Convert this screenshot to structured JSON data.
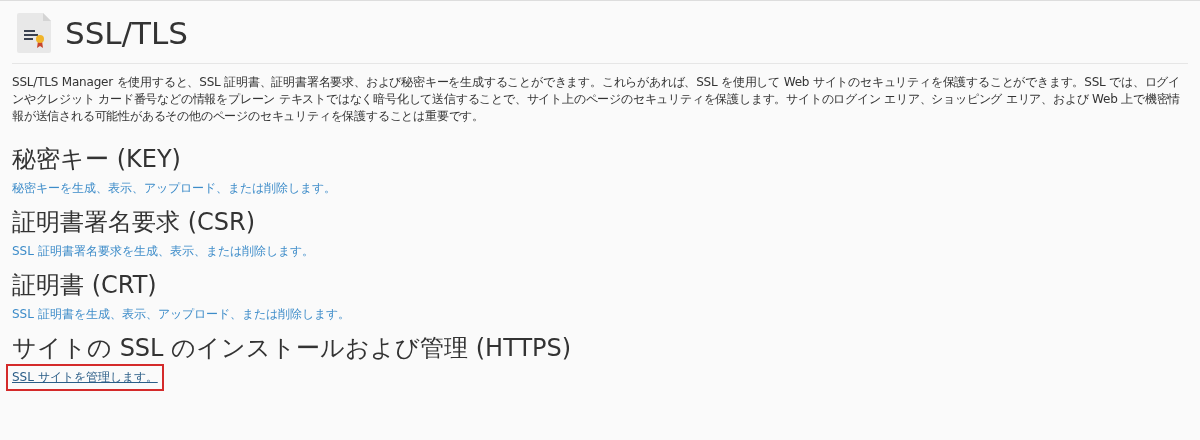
{
  "page": {
    "title": "SSL/TLS"
  },
  "description": "SSL/TLS Manager を使用すると、SSL 証明書、証明書署名要求、および秘密キーを生成することができます。これらがあれば、SSL を使用して Web サイトのセキュリティを保護することができます。SSL では、ログインやクレジット カード番号などの情報をプレーン テキストではなく暗号化して送信することで、サイト上のページのセキュリティを保護します。サイトのログイン エリア、ショッピング エリア、および Web 上で機密情報が送信される可能性があるその他のページのセキュリティを保護することは重要です。",
  "sections": [
    {
      "heading": "秘密キー (KEY)",
      "link": "秘密キーを生成、表示、アップロード、または削除します。",
      "highlighted": false
    },
    {
      "heading": "証明書署名要求 (CSR)",
      "link": "SSL 証明書署名要求を生成、表示、または削除します。",
      "highlighted": false
    },
    {
      "heading": "証明書 (CRT)",
      "link": "SSL 証明書を生成、表示、アップロード、または削除します。",
      "highlighted": false
    },
    {
      "heading": "サイトの SSL のインストールおよび管理 (HTTPS)",
      "link": "SSL サイトを管理します。",
      "highlighted": true
    }
  ]
}
